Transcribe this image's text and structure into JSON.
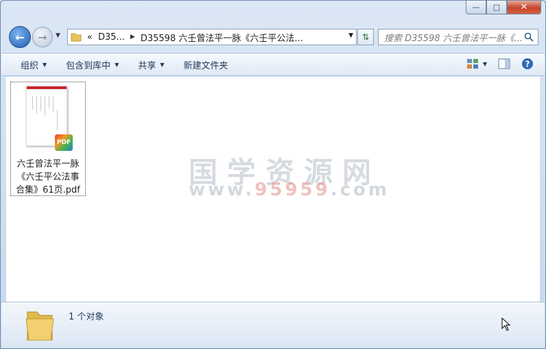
{
  "window": {
    "caption": {
      "minimize": "—",
      "maximize": "□",
      "close": "✕"
    }
  },
  "nav": {
    "back_icon": "back-arrow-icon",
    "forward_icon": "forward-arrow-icon",
    "address": {
      "overflow": "«",
      "crumbs": [
        "D35...",
        "D35598 六壬曾法平一脉《六壬平公法..."
      ]
    },
    "search_placeholder": "搜索 D35598 六壬曾法平一脉《..."
  },
  "toolbar": {
    "organize": "组织",
    "include_library": "包含到库中",
    "share": "共享",
    "new_folder": "新建文件夹"
  },
  "files": [
    {
      "name": "六壬曾法平一脉《六壬平公法事合集》61页.pdf",
      "lines": [
        "六壬曾法平一脉",
        "《六壬平公法事",
        "合集》61页.pdf"
      ],
      "badge": "PDF"
    }
  ],
  "watermark": {
    "cn": "国学资源网",
    "url_prefix": "www.",
    "url_number": "95959",
    "url_suffix": ".com"
  },
  "status": {
    "count": "1 个对象"
  },
  "colors": {
    "accent": "#1e395b",
    "close": "#c4452b",
    "pdf_red": "#c8242b"
  }
}
